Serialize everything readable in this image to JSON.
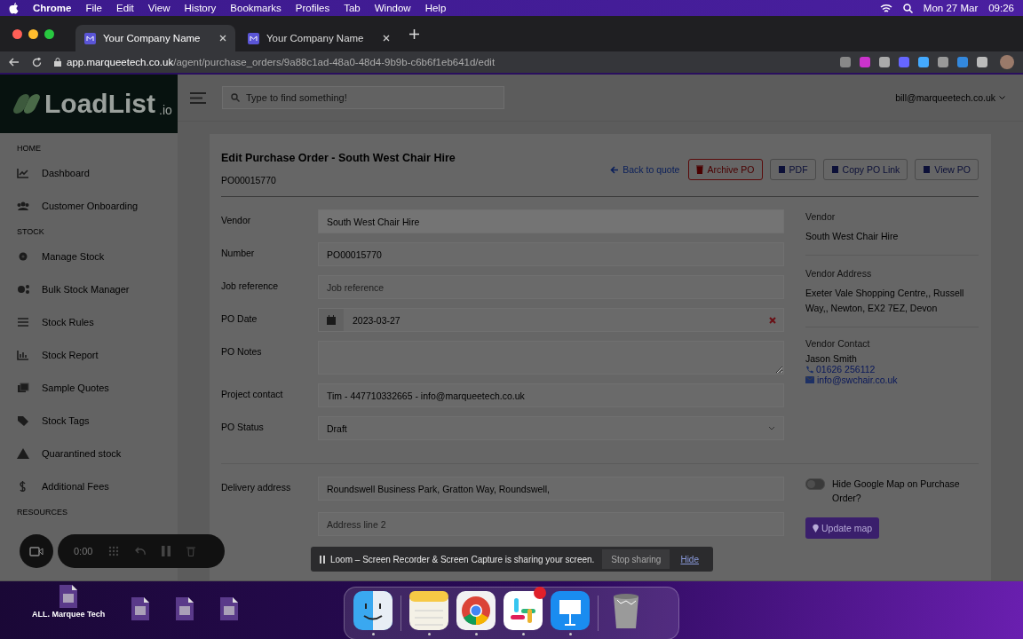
{
  "menubar": {
    "app": "Chrome",
    "menus": [
      "File",
      "Edit",
      "View",
      "History",
      "Bookmarks",
      "Profiles",
      "Tab",
      "Window",
      "Help"
    ],
    "date": "Mon 27 Mar",
    "time": "09:26"
  },
  "browser": {
    "tabs": [
      {
        "title": "Your Company Name",
        "selected": true
      },
      {
        "title": "Your Company Name",
        "selected": false
      }
    ],
    "url_host": "app.marqueetech.co.uk",
    "url_path": "/agent/purchase_orders/9a88c1ad-48a0-48d4-9b9b-c6b6f1eb641d/edit"
  },
  "app": {
    "logo": "LoadList",
    "logo_suffix": ".io",
    "search": {
      "placeholder": "Type to find something!"
    },
    "user": "bill@marqueetech.co.uk"
  },
  "sidebar": [
    {
      "kind": "heading",
      "label": "HOME"
    },
    {
      "kind": "item",
      "label": "Dashboard"
    },
    {
      "kind": "item",
      "label": "Customer Onboarding"
    },
    {
      "kind": "heading",
      "label": "STOCK"
    },
    {
      "kind": "item",
      "label": "Manage Stock"
    },
    {
      "kind": "item",
      "label": "Bulk Stock Manager"
    },
    {
      "kind": "item",
      "label": "Stock Rules"
    },
    {
      "kind": "item",
      "label": "Stock Report"
    },
    {
      "kind": "item",
      "label": "Sample Quotes"
    },
    {
      "kind": "item",
      "label": "Stock Tags"
    },
    {
      "kind": "item",
      "label": "Quarantined stock"
    },
    {
      "kind": "item",
      "label": "Additional Fees"
    },
    {
      "kind": "heading",
      "label": "RESOURCES"
    }
  ],
  "page": {
    "title": "Edit Purchase Order - South West Chair Hire",
    "subtitle": "PO00015770",
    "actions": [
      {
        "label": "Back to quote",
        "kind": "link"
      },
      {
        "label": "Archive PO",
        "kind": "danger"
      },
      {
        "label": "PDF",
        "kind": "outline"
      },
      {
        "label": "Copy PO Link",
        "kind": "outline"
      },
      {
        "label": "View PO",
        "kind": "outline"
      }
    ]
  },
  "form": [
    {
      "label": "Vendor",
      "kind": "readonly",
      "value": "South West Chair Hire"
    },
    {
      "label": "Number",
      "kind": "text",
      "value": "PO00015770"
    },
    {
      "label": "Job reference",
      "kind": "text",
      "placeholder": "Job reference"
    },
    {
      "label": "PO Date",
      "kind": "date",
      "value": "2023-03-27"
    },
    {
      "label": "PO Notes",
      "kind": "textarea"
    },
    {
      "label": "Project contact",
      "kind": "text",
      "value": "Tim - 447710332665 - info@marqueetech.co.uk"
    },
    {
      "label": "PO Status",
      "kind": "select",
      "value": "Draft"
    }
  ],
  "delivery": {
    "label": "Delivery address",
    "line1": "Roundswell Business Park, Gratton Way, Roundswell,",
    "line2_placeholder": "Address line 2"
  },
  "vendor_panel": {
    "vendor_label": "Vendor",
    "vendor": "South West Chair Hire",
    "address_label": "Vendor Address",
    "address": "Exeter Vale Shopping Centre,, Russell Way,, Newton, EX2 7EZ, Devon",
    "contact_label": "Vendor Contact",
    "contact_name": "Jason Smith",
    "phone": "01626 256112",
    "email": "info@swchair.co.uk"
  },
  "map": {
    "toggle_label": "Hide Google Map on Purchase Order?",
    "on": false,
    "button": "Update map"
  },
  "recorder": {
    "timer": "0:00"
  },
  "loom_banner": {
    "message": "Loom – Screen Recorder & Screen Capture is sharing your screen.",
    "stop": "Stop sharing",
    "hide": "Hide"
  },
  "desktop": {
    "files": [
      {
        "kind": "file",
        "label": "ALL. Marquee Tech"
      },
      {
        "kind": "file"
      },
      {
        "kind": "file"
      },
      {
        "kind": "file"
      }
    ]
  },
  "dock": [
    {
      "kind": "finder",
      "running": true,
      "badge": false
    },
    {
      "kind": "notes",
      "running": true,
      "badge": false
    },
    {
      "kind": "chrome",
      "running": true,
      "badge": false
    },
    {
      "kind": "slack",
      "running": true,
      "badge": true
    },
    {
      "kind": "keynote",
      "running": true,
      "badge": false
    },
    {
      "kind": "trash",
      "running": false,
      "badge": false
    }
  ]
}
